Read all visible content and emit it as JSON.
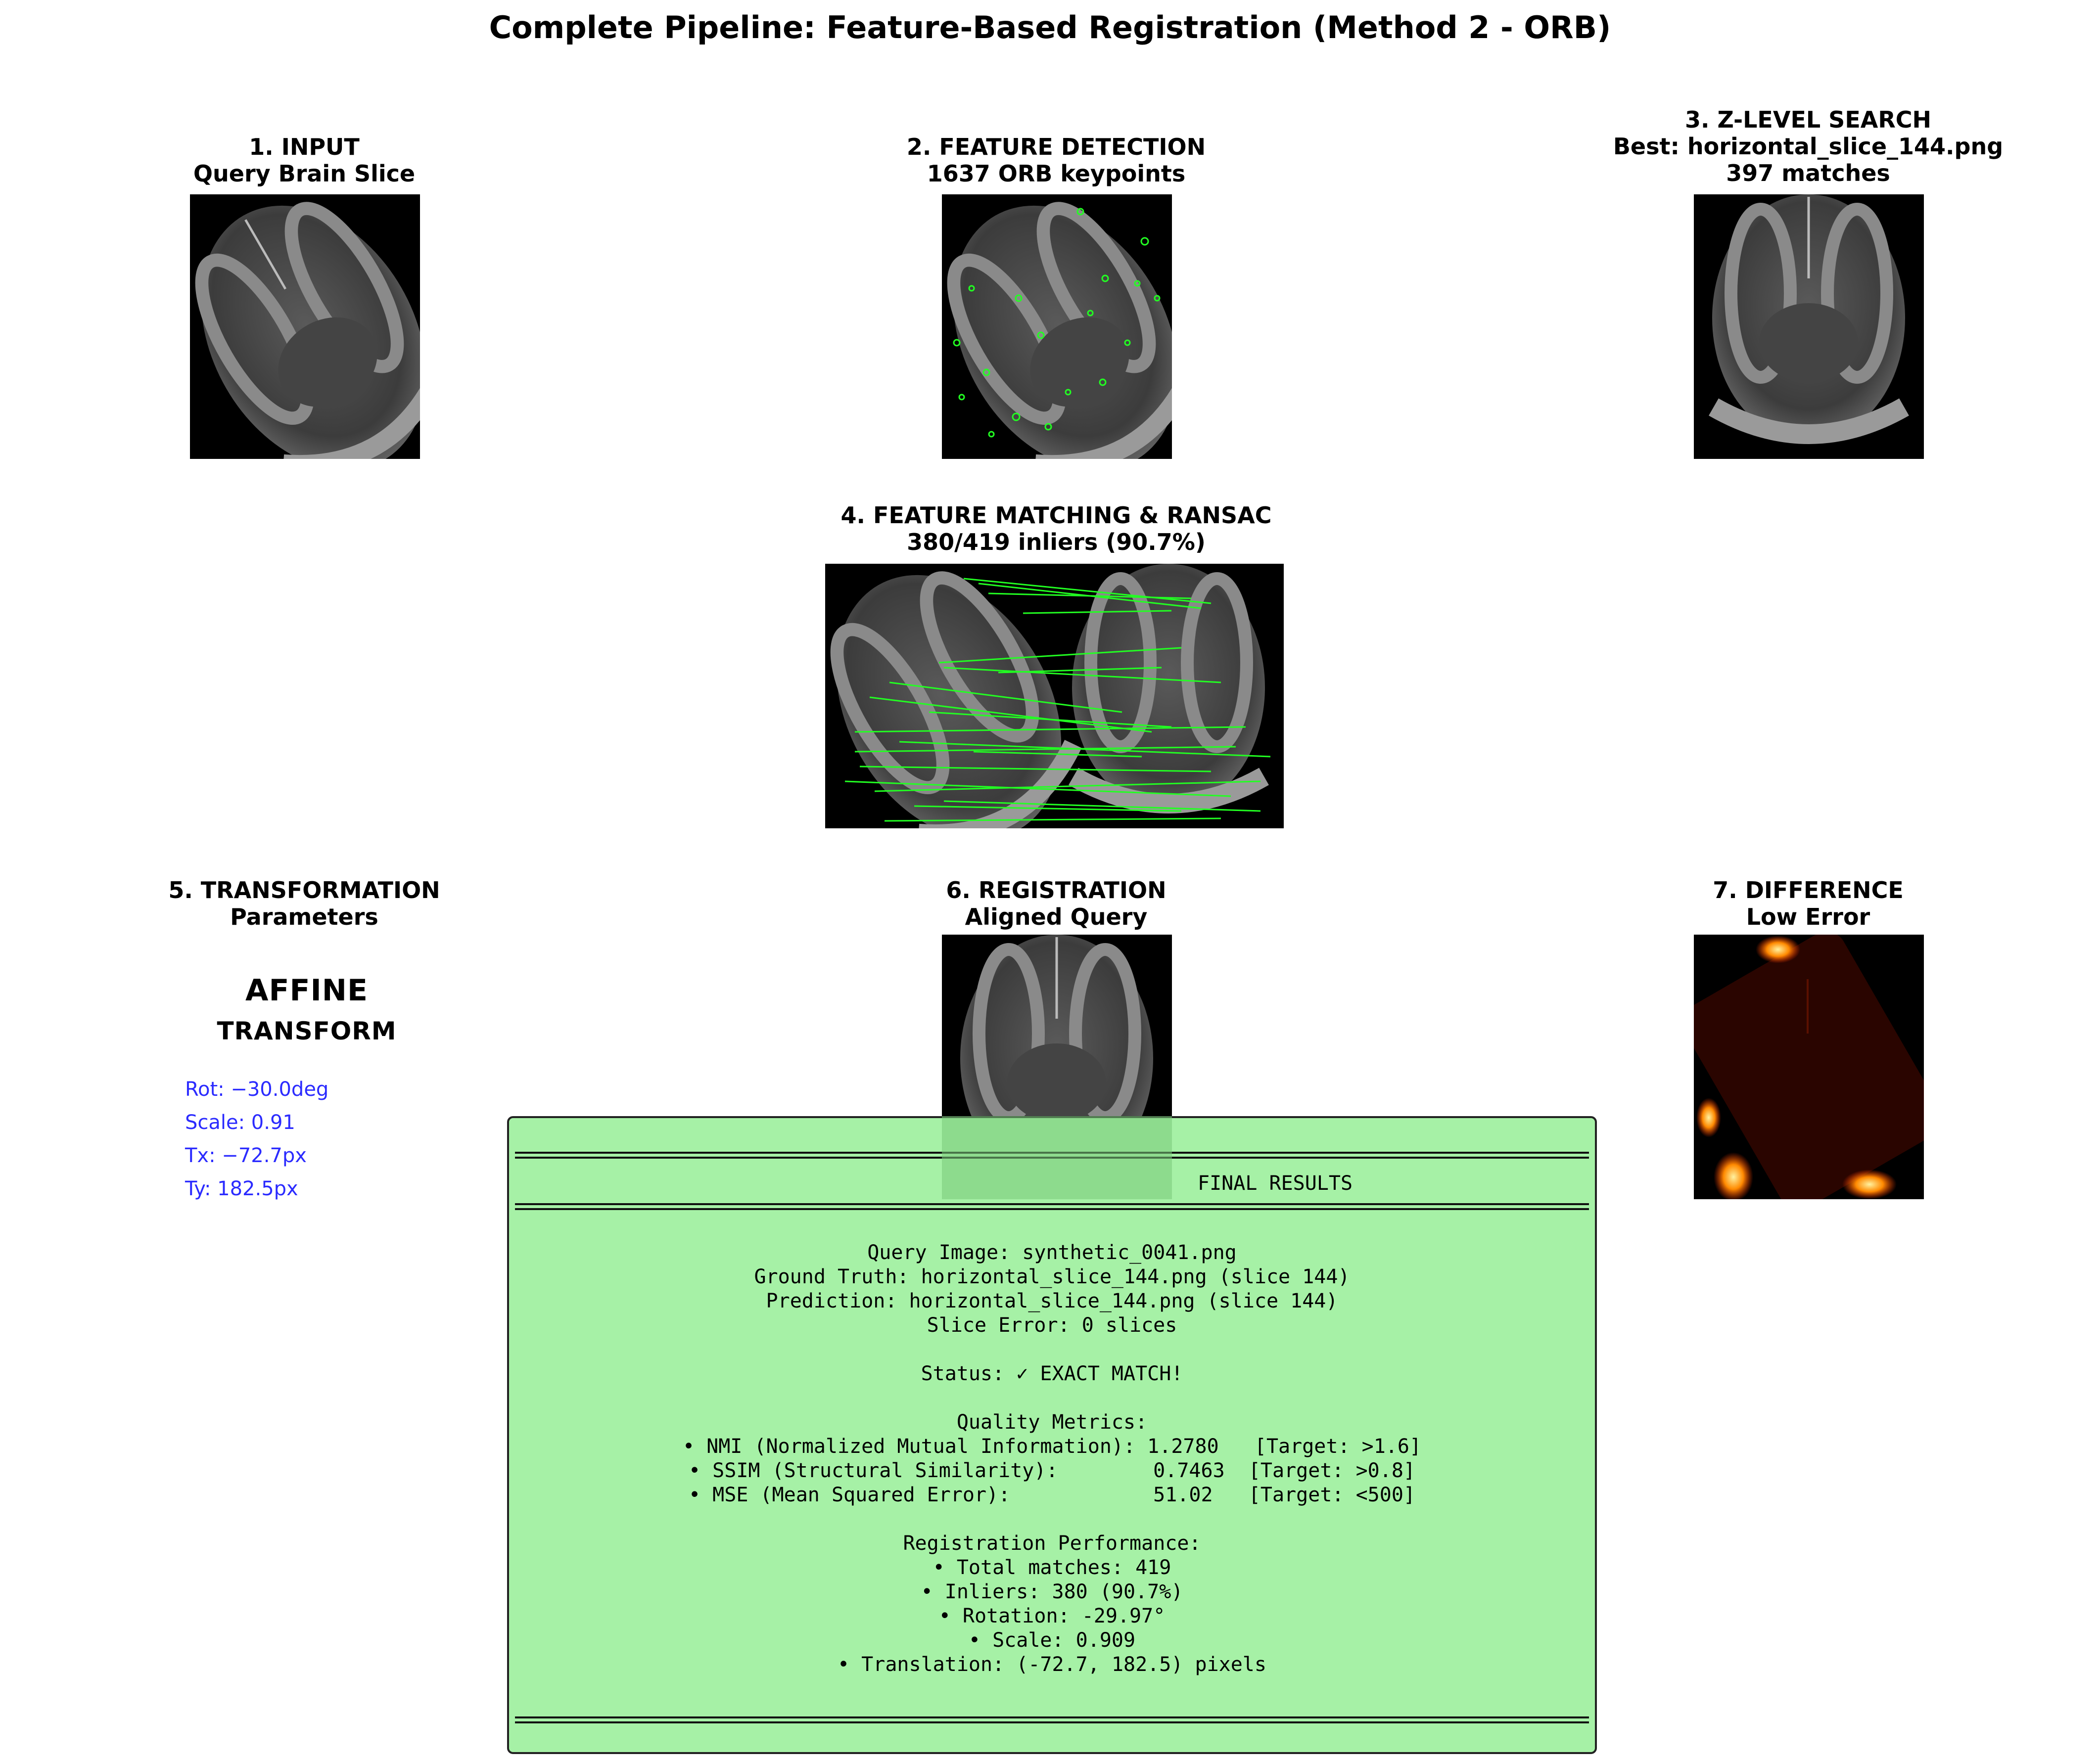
{
  "title": "Complete Pipeline: Feature-Based Registration (Method 2 - ORB)",
  "panels": {
    "input": {
      "title": "1. INPUT",
      "subtitle": "Query Brain Slice"
    },
    "features": {
      "title": "2. FEATURE DETECTION",
      "subtitle": "1637 ORB keypoints"
    },
    "zsearch": {
      "title": "3. Z-LEVEL SEARCH",
      "subtitle": "Best: horizontal_slice_144.png",
      "subtitle2": "397 matches"
    },
    "matching": {
      "title": "4. FEATURE MATCHING & RANSAC",
      "subtitle": "380/419 inliers (90.7%)"
    },
    "transform": {
      "title": "5. TRANSFORMATION",
      "subtitle": "Parameters",
      "heading1": "AFFINE",
      "heading2": "TRANSFORM",
      "rot": "Rot: −30.0deg",
      "scale": "Scale: 0.91",
      "tx": "Tx: −72.7px",
      "ty": "Ty: 182.5px"
    },
    "registration": {
      "title": "6. REGISTRATION",
      "subtitle": "Aligned Query"
    },
    "difference": {
      "title": "7. DIFFERENCE",
      "subtitle": "Low Error"
    }
  },
  "results": {
    "heading": "FINAL RESULTS",
    "lines": [
      "Query Image: synthetic_0041.png",
      "Ground Truth: horizontal_slice_144.png (slice 144)",
      "Prediction: horizontal_slice_144.png (slice 144)",
      "Slice Error: 0 slices",
      "",
      "Status: ✓ EXACT MATCH!",
      "",
      "Quality Metrics:",
      "• NMI (Normalized Mutual Information): 1.2780   [Target: >1.6]",
      "• SSIM (Structural Similarity):        0.7463  [Target: >0.8]",
      "• MSE (Mean Squared Error):            51.02   [Target: <500]",
      "",
      "Registration Performance:",
      "• Total matches: 419",
      "• Inliers: 380 (90.7%)",
      "• Rotation: -29.97°",
      "• Scale: 0.909",
      "• Translation: (-72.7, 182.5) pixels"
    ]
  },
  "colors": {
    "panel_background": "#a6f1a6",
    "match_lines": "#22ff22",
    "param_text": "#2b2bff",
    "heat_low": "#2a0500",
    "heat_high": "#ffd040"
  }
}
